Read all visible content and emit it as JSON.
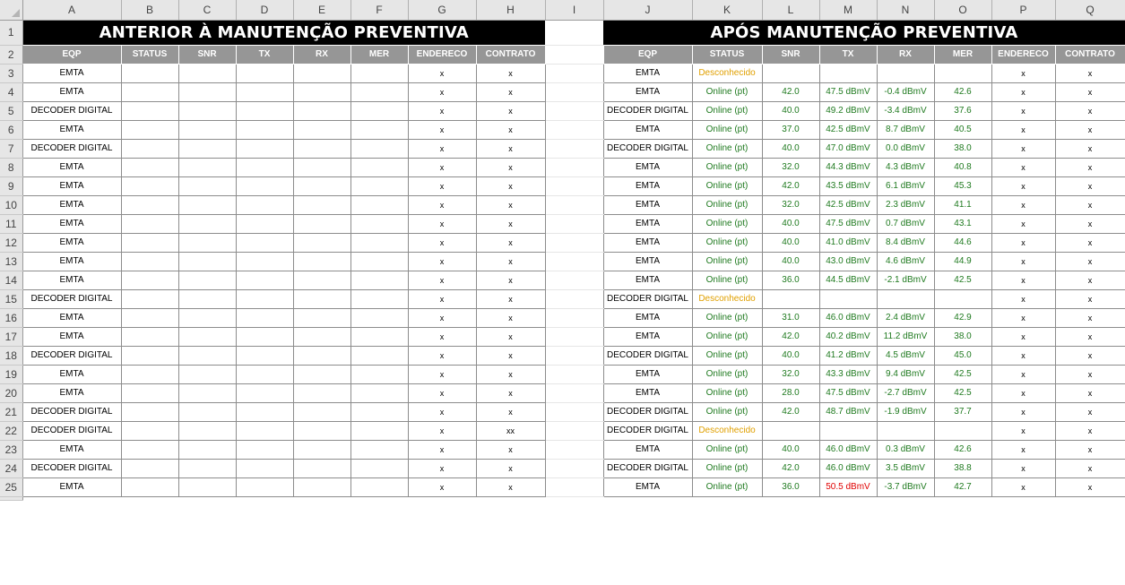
{
  "columns": [
    "A",
    "B",
    "C",
    "D",
    "E",
    "F",
    "G",
    "H",
    "I",
    "J",
    "K",
    "L",
    "M",
    "N",
    "O",
    "P",
    "Q"
  ],
  "title_before": "ANTERIOR À MANUTENÇÃO PREVENTIVA",
  "title_after": "APÓS MANUTENÇÃO PREVENTIVA",
  "headers_before": [
    "EQP",
    "STATUS",
    "SNR",
    "TX",
    "RX",
    "MER",
    "ENDERECO",
    "CONTRATO"
  ],
  "headers_after": [
    "EQP",
    "STATUS",
    "SNR",
    "TX",
    "RX",
    "MER",
    "ENDERECO",
    "CONTRATO"
  ],
  "row_numbers": [
    "1",
    "2",
    "3",
    "4",
    "5",
    "6",
    "7",
    "8",
    "9",
    "10",
    "11",
    "12",
    "13",
    "14",
    "15",
    "16",
    "17",
    "18",
    "19",
    "20",
    "21",
    "22",
    "23",
    "24",
    "25"
  ],
  "colors": {
    "online": "#1f7a1f",
    "unknown": "#e0a000",
    "tx_red": "#e00000",
    "header_gray": "#969696",
    "title_black": "#000000"
  },
  "rows": [
    {
      "eqp": "EMTA",
      "endereco": "x",
      "contrato": "x",
      "after": {
        "eqp": "EMTA",
        "status": "Desconhecido",
        "snr": "",
        "tx": "",
        "rx": "",
        "mer": "",
        "endereco": "x",
        "contrato": "x"
      }
    },
    {
      "eqp": "EMTA",
      "endereco": "x",
      "contrato": "x",
      "after": {
        "eqp": "EMTA",
        "status": "Online (pt)",
        "snr": "42.0",
        "tx": "47.5 dBmV",
        "rx": "-0.4 dBmV",
        "mer": "42.6",
        "endereco": "x",
        "contrato": "x"
      }
    },
    {
      "eqp": "DECODER DIGITAL",
      "endereco": "x",
      "contrato": "x",
      "after": {
        "eqp": "DECODER DIGITAL",
        "status": "Online (pt)",
        "snr": "40.0",
        "tx": "49.2 dBmV",
        "rx": "-3.4 dBmV",
        "mer": "37.6",
        "endereco": "x",
        "contrato": "x"
      }
    },
    {
      "eqp": "EMTA",
      "endereco": "x",
      "contrato": "x",
      "after": {
        "eqp": "EMTA",
        "status": "Online (pt)",
        "snr": "37.0",
        "tx": "42.5 dBmV",
        "rx": "8.7 dBmV",
        "mer": "40.5",
        "endereco": "x",
        "contrato": "x"
      }
    },
    {
      "eqp": "DECODER DIGITAL",
      "endereco": "x",
      "contrato": "x",
      "after": {
        "eqp": "DECODER DIGITAL",
        "status": "Online (pt)",
        "snr": "40.0",
        "tx": "47.0 dBmV",
        "rx": "0.0 dBmV",
        "mer": "38.0",
        "endereco": "x",
        "contrato": "x"
      }
    },
    {
      "eqp": "EMTA",
      "endereco": "x",
      "contrato": "x",
      "after": {
        "eqp": "EMTA",
        "status": "Online (pt)",
        "snr": "32.0",
        "tx": "44.3 dBmV",
        "rx": "4.3 dBmV",
        "mer": "40.8",
        "endereco": "x",
        "contrato": "x"
      }
    },
    {
      "eqp": "EMTA",
      "endereco": "x",
      "contrato": "x",
      "after": {
        "eqp": "EMTA",
        "status": "Online (pt)",
        "snr": "42.0",
        "tx": "43.5 dBmV",
        "rx": "6.1 dBmV",
        "mer": "45.3",
        "endereco": "x",
        "contrato": "x"
      }
    },
    {
      "eqp": "EMTA",
      "endereco": "x",
      "contrato": "x",
      "after": {
        "eqp": "EMTA",
        "status": "Online (pt)",
        "snr": "32.0",
        "tx": "42.5 dBmV",
        "rx": "2.3 dBmV",
        "mer": "41.1",
        "endereco": "x",
        "contrato": "x"
      }
    },
    {
      "eqp": "EMTA",
      "endereco": "x",
      "contrato": "x",
      "after": {
        "eqp": "EMTA",
        "status": "Online (pt)",
        "snr": "40.0",
        "tx": "47.5 dBmV",
        "rx": "0.7 dBmV",
        "mer": "43.1",
        "endereco": "x",
        "contrato": "x"
      }
    },
    {
      "eqp": "EMTA",
      "endereco": "x",
      "contrato": "x",
      "after": {
        "eqp": "EMTA",
        "status": "Online (pt)",
        "snr": "40.0",
        "tx": "41.0 dBmV",
        "rx": "8.4 dBmV",
        "mer": "44.6",
        "endereco": "x",
        "contrato": "x"
      }
    },
    {
      "eqp": "EMTA",
      "endereco": "x",
      "contrato": "x",
      "after": {
        "eqp": "EMTA",
        "status": "Online (pt)",
        "snr": "40.0",
        "tx": "43.0 dBmV",
        "rx": "4.6 dBmV",
        "mer": "44.9",
        "endereco": "x",
        "contrato": "x"
      }
    },
    {
      "eqp": "EMTA",
      "endereco": "x",
      "contrato": "x",
      "after": {
        "eqp": "EMTA",
        "status": "Online (pt)",
        "snr": "36.0",
        "tx": "44.5 dBmV",
        "rx": "-2.1 dBmV",
        "mer": "42.5",
        "endereco": "x",
        "contrato": "x"
      }
    },
    {
      "eqp": "DECODER DIGITAL",
      "endereco": "x",
      "contrato": "x",
      "after": {
        "eqp": "DECODER DIGITAL",
        "status": "Desconhecido",
        "snr": "",
        "tx": "",
        "rx": "",
        "mer": "",
        "endereco": "x",
        "contrato": "x"
      }
    },
    {
      "eqp": "EMTA",
      "endereco": "x",
      "contrato": "x",
      "after": {
        "eqp": "EMTA",
        "status": "Online (pt)",
        "snr": "31.0",
        "tx": "46.0 dBmV",
        "rx": "2.4 dBmV",
        "mer": "42.9",
        "endereco": "x",
        "contrato": "x"
      }
    },
    {
      "eqp": "EMTA",
      "endereco": "x",
      "contrato": "x",
      "after": {
        "eqp": "EMTA",
        "status": "Online (pt)",
        "snr": "42.0",
        "tx": "40.2 dBmV",
        "rx": "11.2 dBmV",
        "mer": "38.0",
        "endereco": "x",
        "contrato": "x"
      }
    },
    {
      "eqp": "DECODER DIGITAL",
      "endereco": "x",
      "contrato": "x",
      "after": {
        "eqp": "DECODER DIGITAL",
        "status": "Online (pt)",
        "snr": "40.0",
        "tx": "41.2 dBmV",
        "rx": "4.5 dBmV",
        "mer": "45.0",
        "endereco": "x",
        "contrato": "x"
      }
    },
    {
      "eqp": "EMTA",
      "endereco": "x",
      "contrato": "x",
      "after": {
        "eqp": "EMTA",
        "status": "Online (pt)",
        "snr": "32.0",
        "tx": "43.3 dBmV",
        "rx": "9.4 dBmV",
        "mer": "42.5",
        "endereco": "x",
        "contrato": "x"
      }
    },
    {
      "eqp": "EMTA",
      "endereco": "x",
      "contrato": "x",
      "after": {
        "eqp": "EMTA",
        "status": "Online (pt)",
        "snr": "28.0",
        "tx": "47.5 dBmV",
        "rx": "-2.7 dBmV",
        "mer": "42.5",
        "endereco": "x",
        "contrato": "x"
      }
    },
    {
      "eqp": "DECODER DIGITAL",
      "endereco": "x",
      "contrato": "x",
      "after": {
        "eqp": "DECODER DIGITAL",
        "status": "Online (pt)",
        "snr": "42.0",
        "tx": "48.7 dBmV",
        "rx": "-1.9 dBmV",
        "mer": "37.7",
        "endereco": "x",
        "contrato": "x"
      }
    },
    {
      "eqp": "DECODER DIGITAL",
      "endereco": "x",
      "contrato": "xx",
      "after": {
        "eqp": "DECODER DIGITAL",
        "status": "Desconhecido",
        "snr": "",
        "tx": "",
        "rx": "",
        "mer": "",
        "endereco": "x",
        "contrato": "x"
      }
    },
    {
      "eqp": "EMTA",
      "endereco": "x",
      "contrato": "x",
      "after": {
        "eqp": "EMTA",
        "status": "Online (pt)",
        "snr": "40.0",
        "tx": "46.0 dBmV",
        "rx": "0.3 dBmV",
        "mer": "42.6",
        "endereco": "x",
        "contrato": "x"
      }
    },
    {
      "eqp": "DECODER DIGITAL",
      "endereco": "x",
      "contrato": "x",
      "after": {
        "eqp": "DECODER DIGITAL",
        "status": "Online (pt)",
        "snr": "42.0",
        "tx": "46.0 dBmV",
        "rx": "3.5 dBmV",
        "mer": "38.8",
        "endereco": "x",
        "contrato": "x"
      }
    },
    {
      "eqp": "EMTA",
      "endereco": "x",
      "contrato": "x",
      "after": {
        "eqp": "EMTA",
        "status": "Online (pt)",
        "snr": "36.0",
        "tx": "50.5 dBmV",
        "rx": "-3.7 dBmV",
        "mer": "42.7",
        "endereco": "x",
        "contrato": "x",
        "tx_alert": true
      }
    }
  ]
}
